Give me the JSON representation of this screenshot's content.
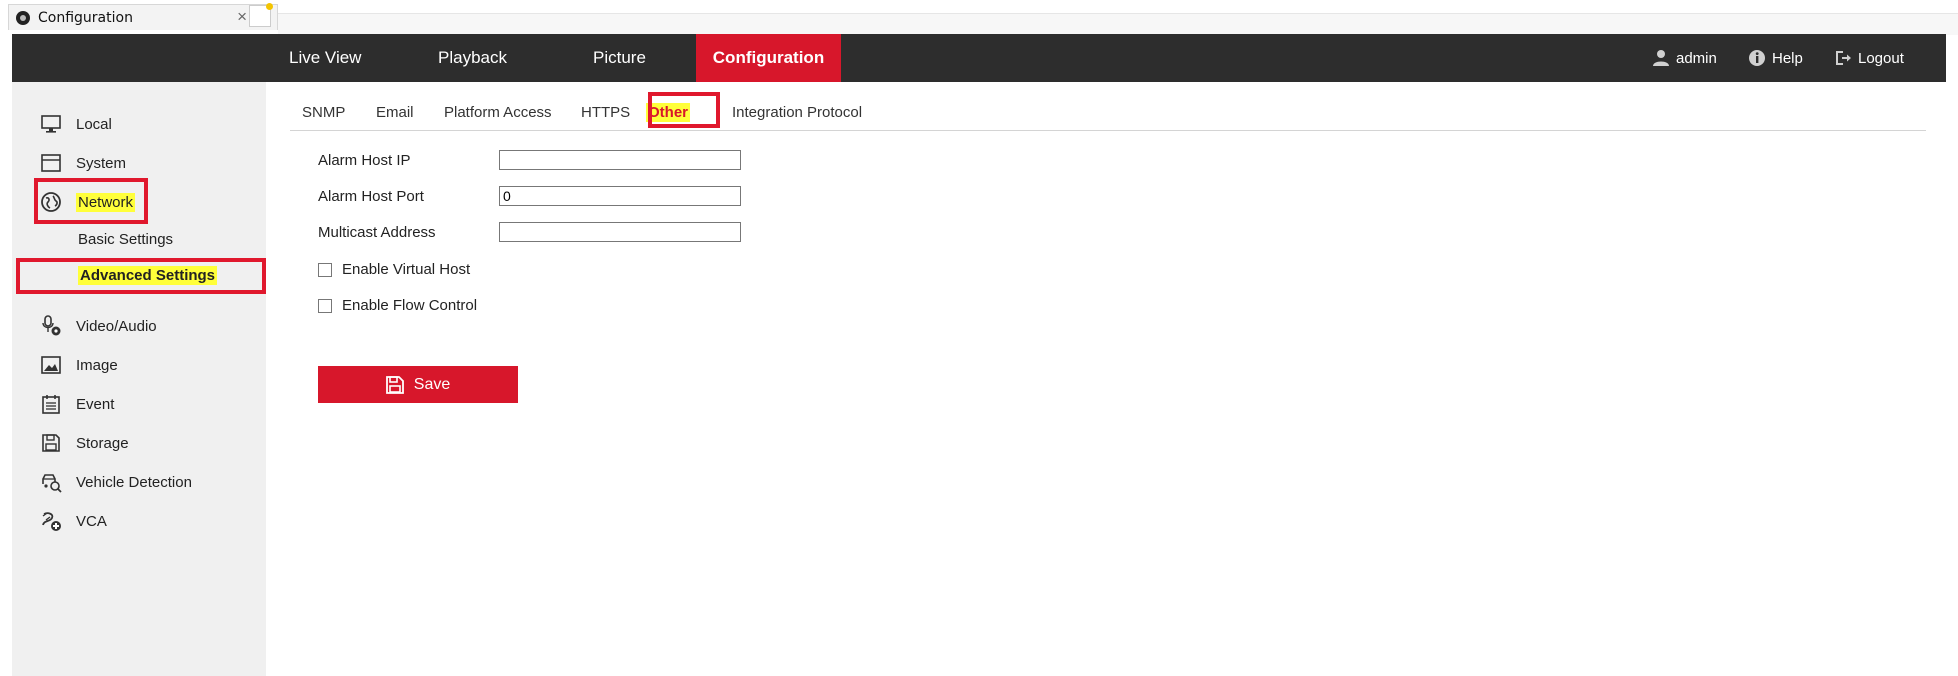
{
  "browser": {
    "tab_title": "Configuration",
    "close_glyph": "×"
  },
  "topnav": {
    "items": [
      {
        "label": "Live View"
      },
      {
        "label": "Playback"
      },
      {
        "label": "Picture"
      },
      {
        "label": "Configuration",
        "active": true
      }
    ],
    "user": {
      "label": "admin",
      "icon": "user-icon"
    },
    "help": {
      "label": "Help",
      "icon": "info-icon"
    },
    "logout": {
      "label": "Logout",
      "icon": "logout-icon"
    }
  },
  "sidebar": {
    "items": [
      {
        "label": "Local",
        "icon": "monitor-icon"
      },
      {
        "label": "System",
        "icon": "window-icon"
      },
      {
        "label": "Network",
        "icon": "globe-icon",
        "active": true
      },
      {
        "label": "Video/Audio",
        "icon": "microphone-icon"
      },
      {
        "label": "Image",
        "icon": "image-icon"
      },
      {
        "label": "Event",
        "icon": "calendar-icon"
      },
      {
        "label": "Storage",
        "icon": "floppy-icon"
      },
      {
        "label": "Vehicle Detection",
        "icon": "vehicle-search-icon"
      },
      {
        "label": "VCA",
        "icon": "vca-icon"
      }
    ],
    "network_sub": [
      {
        "label": "Basic Settings"
      },
      {
        "label": "Advanced Settings",
        "active": true
      }
    ]
  },
  "subtabs": [
    {
      "label": "SNMP"
    },
    {
      "label": "Email"
    },
    {
      "label": "Platform Access"
    },
    {
      "label": "HTTPS"
    },
    {
      "label": "Other",
      "active": true
    },
    {
      "label": "Integration Protocol"
    }
  ],
  "form": {
    "alarm_host_ip": {
      "label": "Alarm Host IP",
      "value": ""
    },
    "alarm_host_port": {
      "label": "Alarm Host Port",
      "value": "0"
    },
    "multicast_address": {
      "label": "Multicast Address",
      "value": ""
    },
    "enable_virtual_host": {
      "label": "Enable Virtual Host",
      "checked": false
    },
    "enable_flow_control": {
      "label": "Enable Flow Control",
      "checked": false
    },
    "save_label": "Save"
  },
  "colors": {
    "accent_red": "#d7172b",
    "highlight_yellow": "#ffff3a",
    "nav_bg": "#2d2d2d",
    "sidebar_bg": "#f0f0f0"
  }
}
